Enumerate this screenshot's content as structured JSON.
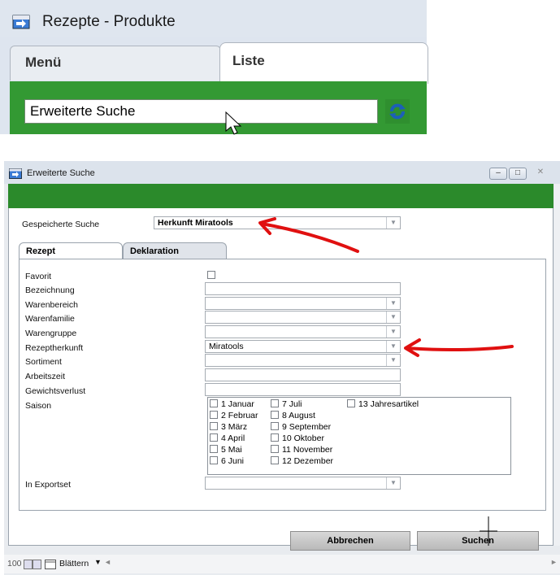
{
  "top_window": {
    "title": "Rezepte - Produkte",
    "tabs": [
      "Menü",
      "Liste"
    ],
    "search_value": "Erweiterte Suche",
    "accent_color": "#339933"
  },
  "dialog": {
    "title": "Erweiterte Suche",
    "saved_search_label": "Gespeicherte Suche",
    "saved_search_value": "Herkunft Miratools",
    "tabs": [
      "Rezept",
      "Deklaration"
    ],
    "fields": [
      {
        "label": "Favorit",
        "type": "checkbox"
      },
      {
        "label": "Bezeichnung",
        "type": "text",
        "value": ""
      },
      {
        "label": "Warenbereich",
        "type": "combo",
        "value": ""
      },
      {
        "label": "Warenfamilie",
        "type": "combo",
        "value": ""
      },
      {
        "label": "Warengruppe",
        "type": "combo",
        "value": ""
      },
      {
        "label": "Rezeptherkunft",
        "type": "combo",
        "value": "Miratools"
      },
      {
        "label": "Sortiment",
        "type": "combo",
        "value": ""
      },
      {
        "label": "Arbeitszeit",
        "type": "text",
        "value": ""
      },
      {
        "label": "Gewichtsverlust",
        "type": "text",
        "value": ""
      },
      {
        "label": "Saison",
        "type": "checklist"
      },
      {
        "label": "In Exportset",
        "type": "combo",
        "value": ""
      }
    ],
    "saison": {
      "col1": [
        "1 Januar",
        "2 Februar",
        "3 März",
        "4 April",
        "5 Mai",
        "6 Juni"
      ],
      "col2": [
        "7 Juli",
        "8 August",
        "9 September",
        "10 Oktober",
        "11 November",
        "12 Dezember"
      ],
      "col3": [
        "13 Jahresartikel"
      ]
    },
    "buttons": {
      "cancel": "Abbrechen",
      "search": "Suchen"
    },
    "status": {
      "zoom": "100",
      "mode": "Blättern"
    }
  }
}
